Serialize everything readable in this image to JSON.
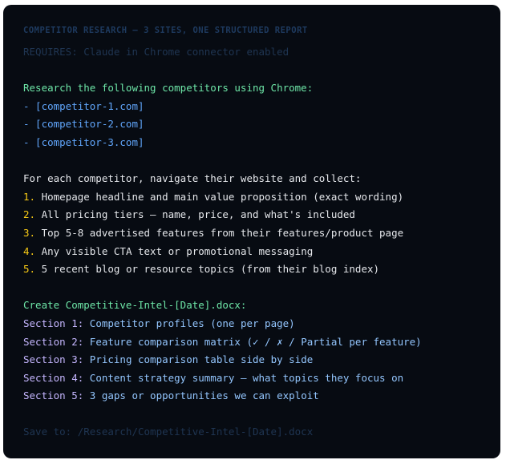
{
  "header": {
    "title": "COMPETITOR RESEARCH — 3 SITES, ONE STRUCTURED REPORT",
    "requires": "REQUIRES: Claude in Chrome connector enabled"
  },
  "research": {
    "intro": "Research the following competitors using Chrome:",
    "sites": [
      "- [competitor-1.com]",
      "- [competitor-2.com]",
      "- [competitor-3.com]"
    ]
  },
  "collect": {
    "intro": "For each competitor, navigate their website and collect:",
    "items": [
      {
        "num": "1.",
        "text": "Homepage headline and main value proposition (exact wording)"
      },
      {
        "num": "2.",
        "text": "All pricing tiers — name, price, and what's included"
      },
      {
        "num": "3.",
        "text": "Top 5-8 advertised features from their features/product page"
      },
      {
        "num": "4.",
        "text": "Any visible CTA text or promotional messaging"
      },
      {
        "num": "5.",
        "text": "5 recent blog or resource topics (from their blog index)"
      }
    ]
  },
  "create": {
    "intro": "Create Competitive-Intel-[Date].docx:",
    "sections": [
      {
        "label": "Section 1:",
        "text": "Competitor profiles (one per page)"
      },
      {
        "label": "Section 2:",
        "text": "Feature comparison matrix (✓ / ✗ / Partial per feature)"
      },
      {
        "label": "Section 3:",
        "text": "Pricing comparison table side by side"
      },
      {
        "label": "Section 4:",
        "text": "Content strategy summary — what topics they focus on"
      },
      {
        "label": "Section 5:",
        "text": "3 gaps or opportunities we can exploit"
      }
    ]
  },
  "footer": {
    "save": "Save to: /Research/Competitive-Intel-[Date].docx"
  }
}
